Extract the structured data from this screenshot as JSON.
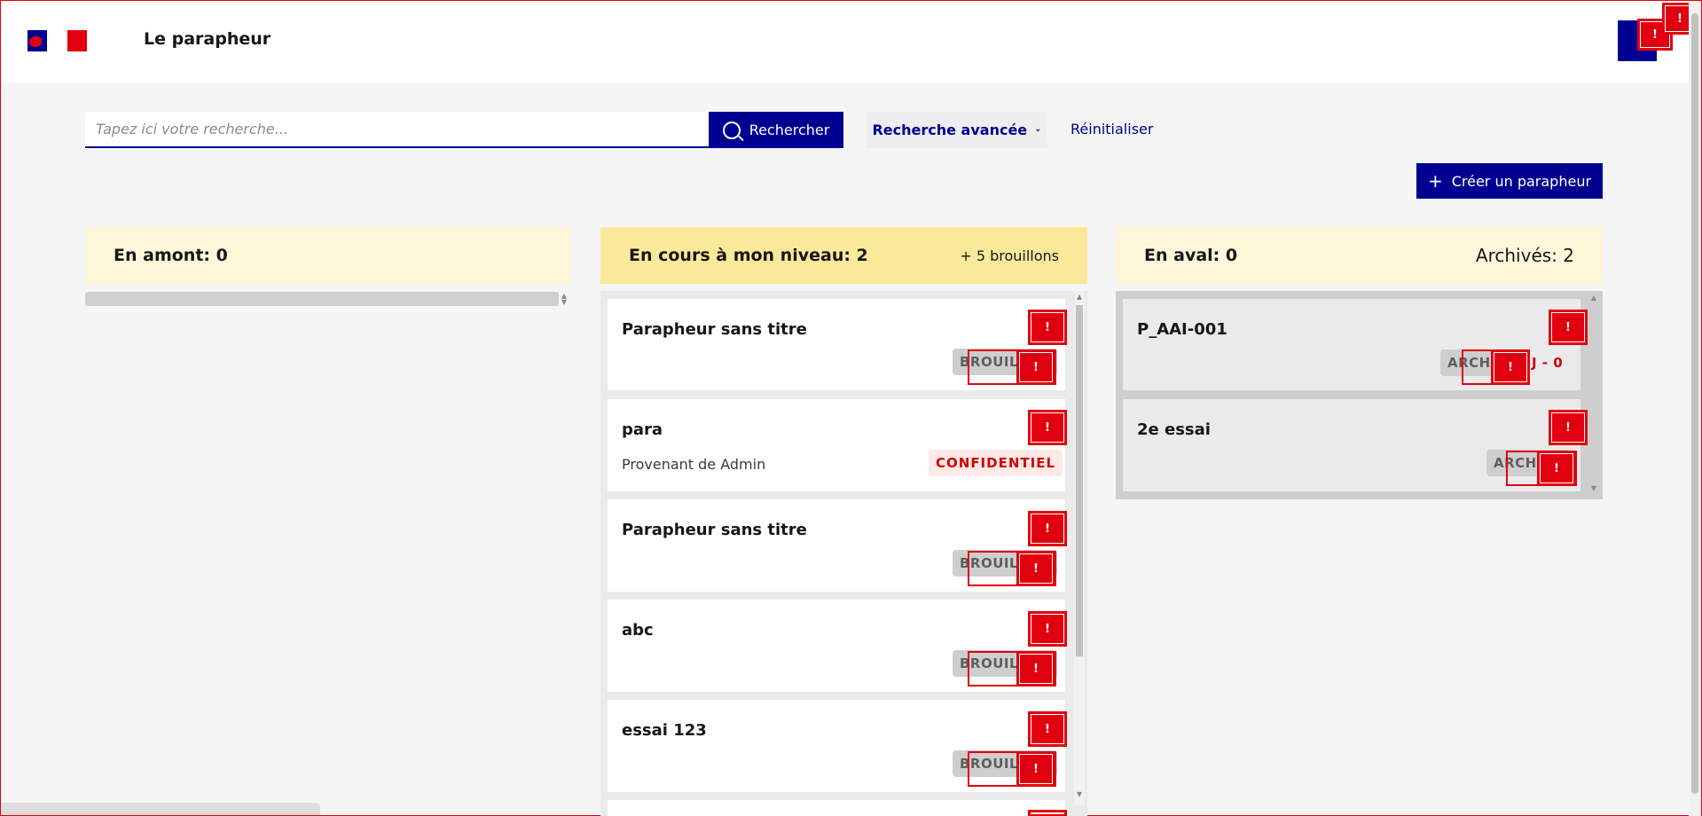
{
  "header": {
    "logo_label": "République Française",
    "app_title": "Le parapheur"
  },
  "search": {
    "placeholder": "Tapez ici votre recherche...",
    "button_label": "Rechercher",
    "advanced_label": "Recherche avancée",
    "reset_label": "Réinitialiser"
  },
  "actions": {
    "create_label": "Créer un parapheur"
  },
  "columns": {
    "upstream": {
      "title": "En amont: 0"
    },
    "current": {
      "title": "En cours à mon niveau: 2",
      "extra": "+ 5 brouillons",
      "cards": [
        {
          "name": "Parapheur sans titre",
          "badge": "BROUILLON"
        },
        {
          "name": "para",
          "origin": "Provenant de Admin",
          "badge": "CONFIDENTIEL"
        },
        {
          "name": "Parapheur sans titre",
          "badge": "BROUILLON"
        },
        {
          "name": "abc",
          "badge": "BROUILLON"
        },
        {
          "name": "essai 123",
          "badge": "BROUILLON"
        }
      ]
    },
    "downstream": {
      "title": "En aval: 0",
      "extra": "Archivés: 2",
      "cards": [
        {
          "name": "P_AAI-001",
          "badge": "ARCHIVÉ",
          "deadline": "J - 0"
        },
        {
          "name": "2e essai",
          "badge": "ARCHIVÉ"
        }
      ]
    }
  },
  "error_marker": "!",
  "colors": {
    "primary": "#000091",
    "danger": "#e1000f",
    "column_header": "#fef7da",
    "column_header_active": "#fbe99a"
  }
}
